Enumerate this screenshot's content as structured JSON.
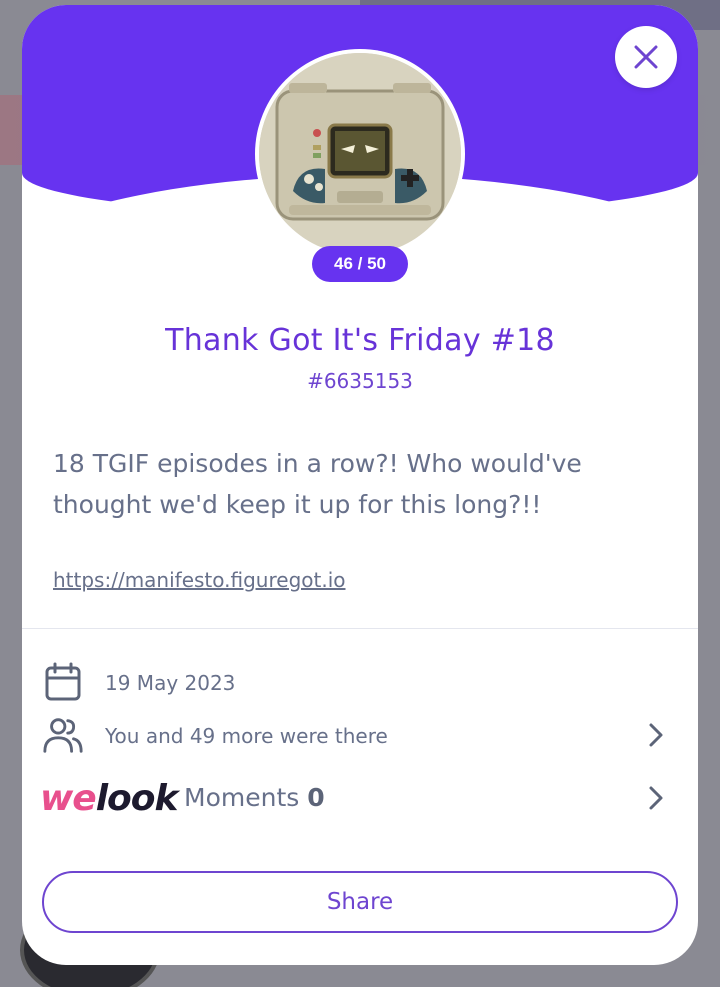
{
  "modal": {
    "progress_badge": "46 / 50",
    "title": "Thank Got It's Friday #18",
    "event_id": "#6635153",
    "description": "18 TGIF episodes in a row?! Who would've thought we'd keep it up for this long?!!",
    "link": "https://manifesto.figuregot.io",
    "date": "19 May 2023",
    "attendees": "You and 49 more were there",
    "welook": {
      "brand_we": "we",
      "brand_look": "look",
      "moments_label": "Moments",
      "moments_count": "0"
    },
    "share_label": "Share"
  },
  "icons": {
    "close": "close-icon",
    "calendar": "calendar-icon",
    "users": "users-icon",
    "chevron": "chevron-right-icon"
  },
  "colors": {
    "accent": "#6733f0",
    "title": "#6733d8",
    "text": "#67708a",
    "welook_pink": "#e8508d"
  }
}
